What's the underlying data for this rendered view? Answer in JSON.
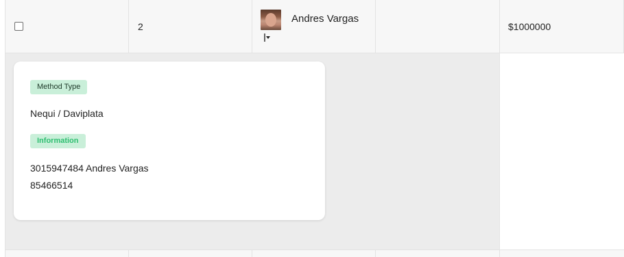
{
  "row": {
    "id": "2",
    "name": "Andres Vargas",
    "status": "",
    "amount": "$1000000"
  },
  "details": {
    "method_type_badge": "Method Type",
    "method_value": "Nequi / Daviplata",
    "information_badge": "Information",
    "information_lines": [
      "3015947484 Andres Vargas",
      "85466514"
    ]
  },
  "colors": {
    "badge_bg": "#c9efd9",
    "info_badge_text": "#2fbf71",
    "expand_bg": "#ececec",
    "row_bg": "#f7f7f7"
  },
  "icons": {
    "avatar": "user-photo",
    "dropdown": "dropdown-caret-icon"
  }
}
